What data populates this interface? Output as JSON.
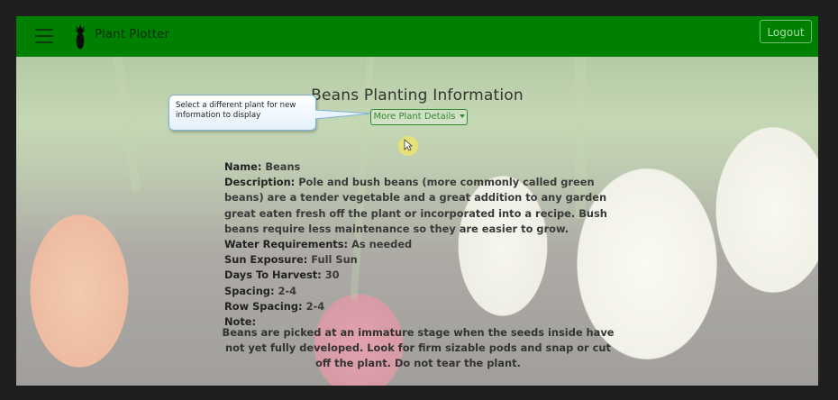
{
  "navbar": {
    "brand": "Plant Plotter",
    "logout_label": "Logout"
  },
  "page": {
    "title": "Beans Planting Information",
    "tooltip": "Select a different plant for new information to display",
    "details_button": "More Plant Details"
  },
  "plant": {
    "name_label": "Name:",
    "name": "Beans",
    "description_label": "Description:",
    "description": "Pole and bush beans (more commonly called green beans) are a tender vegetable and a great addition to any garden great eaten fresh off the plant or incorporated into a recipe. Bush beans require less maintenance so they are easier to grow.",
    "water_label": "Water Requirements:",
    "water": "As needed",
    "sun_label": "Sun Exposure:",
    "sun": "Full Sun",
    "harvest_label": "Days To Harvest:",
    "harvest": "30",
    "spacing_label": "Spacing:",
    "spacing": "2-4",
    "row_spacing_label": "Row Spacing:",
    "row_spacing": "2-4",
    "note_label": "Note:",
    "note": "Beans are picked at an immature stage when the seeds inside have not yet fully developed. Look for firm sizable pods and snap or cut off the plant. Do not tear the plant."
  },
  "colors": {
    "navbar": "#008000",
    "accent": "#2e8b2e"
  }
}
